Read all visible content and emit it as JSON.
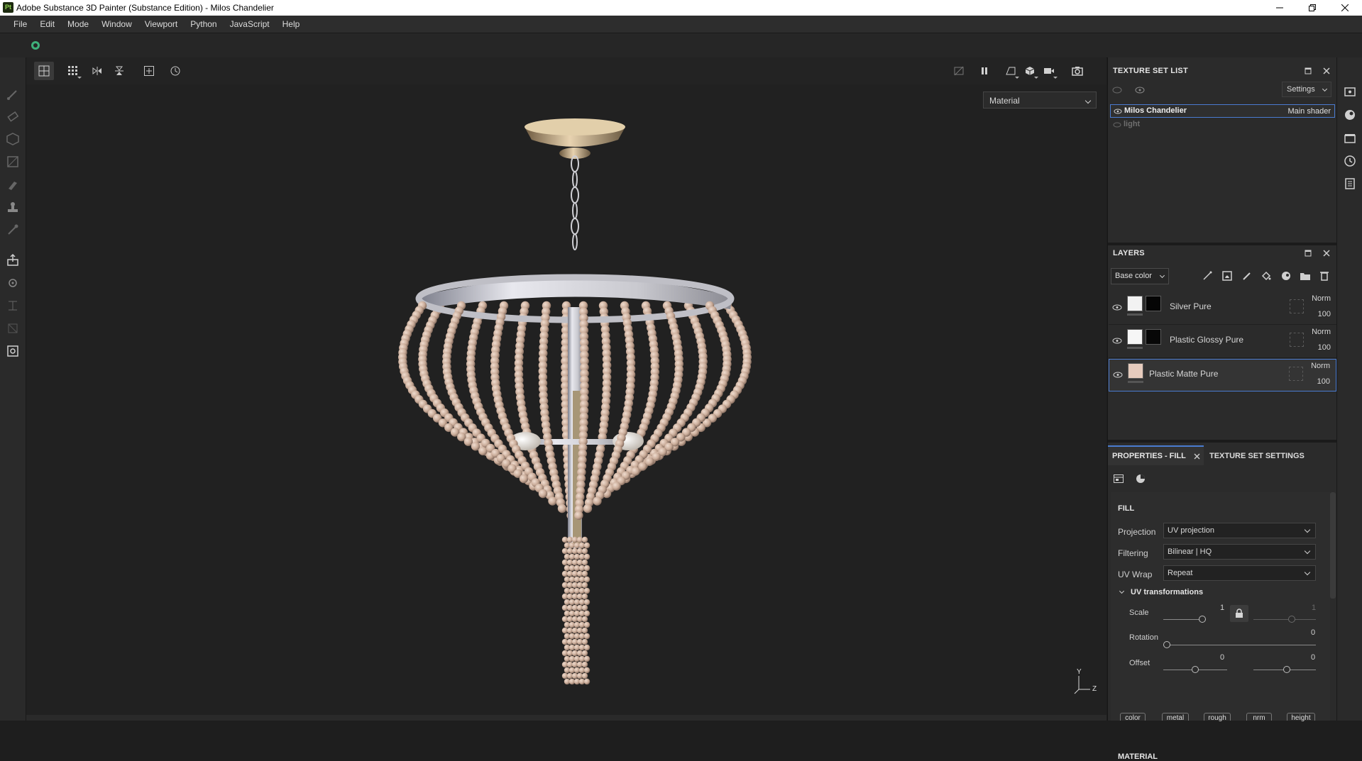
{
  "window": {
    "title": "Adobe Substance 3D Painter (Substance Edition) - Milos Chandelier",
    "logo_text": "Pt"
  },
  "menu": [
    "File",
    "Edit",
    "Mode",
    "Window",
    "Viewport",
    "Python",
    "JavaScript",
    "Help"
  ],
  "viewport": {
    "material_select": "Material",
    "axis_y": "Y",
    "axis_z": "Z"
  },
  "texture_set_list": {
    "title": "TEXTURE SET LIST",
    "settings_label": "Settings",
    "items": [
      {
        "name": "Milos Chandelier",
        "shader": "Main shader",
        "selected": true
      },
      {
        "name": "light",
        "shader": "",
        "selected": false
      }
    ]
  },
  "layers": {
    "title": "LAYERS",
    "channel_select": "Base color",
    "items": [
      {
        "name": "Silver Pure",
        "blend": "Norm",
        "opacity": "100"
      },
      {
        "name": "Plastic Glossy Pure",
        "blend": "Norm",
        "opacity": "100"
      },
      {
        "name": "Plastic Matte Pure",
        "blend": "Norm",
        "opacity": "100"
      }
    ]
  },
  "properties": {
    "tab_fill": "PROPERTIES - FILL",
    "tab_texture_set": "TEXTURE SET SETTINGS",
    "fill_heading": "FILL",
    "projection_label": "Projection",
    "projection_value": "UV projection",
    "filtering_label": "Filtering",
    "filtering_value": "Bilinear | HQ",
    "uvwrap_label": "UV Wrap",
    "uvwrap_value": "Repeat",
    "uv_transform_heading": "UV transformations",
    "scale_label": "Scale",
    "scale_value": "1",
    "scale_value2": "1",
    "rotation_label": "Rotation",
    "rotation_value": "0",
    "offset_label": "Offset",
    "offset_value1": "0",
    "offset_value2": "0",
    "material_heading": "MATERIAL",
    "material_buttons": [
      "color",
      "metal",
      "rough",
      "nrm",
      "height"
    ]
  },
  "colors": {
    "accent": "#4a7bd0",
    "panel_bg": "#2b2b2b",
    "viewport_bg": "#212121",
    "bead": "#c9ab98"
  }
}
